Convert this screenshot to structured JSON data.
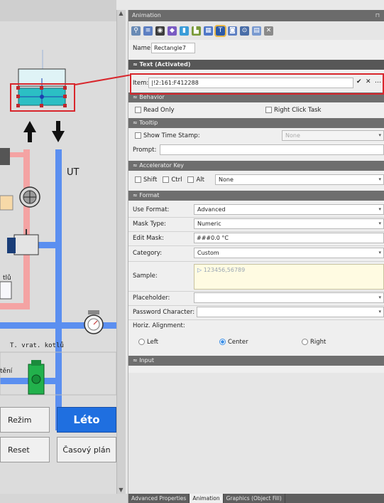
{
  "canvas": {
    "ut_label": "UT",
    "tvrat_label": "T. vrat. kotlů",
    "kotlu_label": "tlů",
    "teni_label": "tění",
    "rezim_button": "Režim",
    "reset_button": "Reset",
    "leto_button": "Léto",
    "casovy_button": "Časový plán"
  },
  "panel": {
    "title": "Animation",
    "name_label": "Name:",
    "name_value": "Rectangle7",
    "text_section": "Text (Activated)",
    "item_label": "Item:",
    "item_value": "|!2:161:F412288",
    "behavior_section": "Behavior",
    "read_only": "Read Only",
    "right_click_task": "Right Click Task",
    "tooltip_section": "Tooltip",
    "show_time_stamp": "Show Time Stamp:",
    "time_stamp_value": "None",
    "prompt_label": "Prompt:",
    "accel_section": "Accelerator Key",
    "shift": "Shift",
    "ctrl": "Ctrl",
    "alt": "Alt",
    "accel_value": "None",
    "format_section": "Format",
    "use_format_label": "Use Format:",
    "use_format_value": "Advanced",
    "mask_type_label": "Mask Type:",
    "mask_type_value": "Numeric",
    "edit_mask_label": "Edit Mask:",
    "edit_mask_value": "###0.0 °C",
    "category_label": "Category:",
    "category_value": "Custom",
    "sample_label": "Sample:",
    "sample_value": "123456,56789",
    "placeholder_label": "Placeholder:",
    "password_label": "Password Character:",
    "horiz_label": "Horiz. Alignment:",
    "align_left": "Left",
    "align_center": "Center",
    "align_right": "Right",
    "input_section": "Input",
    "tabs": [
      "Advanced Properties",
      "Animation",
      "Graphics (Object Fill)"
    ]
  },
  "colors": {
    "highlight": "#d8262c",
    "leto_blue": "#1f6fe0",
    "pipe_red": "#f4a3a3",
    "pipe_blue": "#5b8ff0",
    "tank_teal": "#2bbfc4"
  }
}
